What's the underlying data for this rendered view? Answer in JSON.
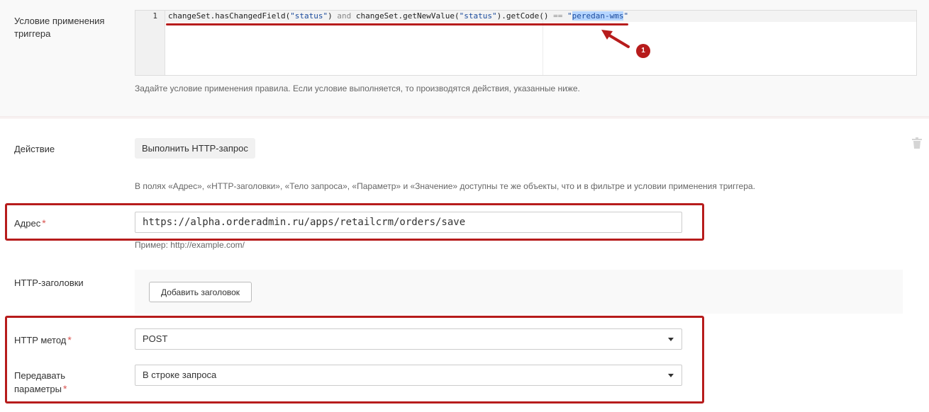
{
  "trigger_condition": {
    "label": "Условие применения триггера",
    "line_number": "1",
    "code": {
      "p1": "changeSet.hasChangedField(",
      "s1": "\"status\"",
      "p2": ") ",
      "k1": "and",
      "p3": " changeSet.getNewValue(",
      "s2": "\"status\"",
      "p4": ").getCode() ",
      "k2": "==",
      "p5": " ",
      "s3a": "\"",
      "s3b": "peredan-wms",
      "s3c": "\""
    },
    "hint": "Задайте условие применения правила. Если условие выполняется, то производятся действия, указанные ниже.",
    "annotation_badge": "1"
  },
  "action": {
    "label": "Действие",
    "button_label": "Выполнить HTTP-запрос",
    "hint": "В полях «Адрес», «HTTP-заголовки», «Тело запроса», «Параметр» и «Значение» доступны те же объекты, что и в фильтре и условии применения триггера."
  },
  "address": {
    "label": "Адрес",
    "required_mark": "*",
    "value": "https://alpha.orderadmin.ru/apps/retailcrm/orders/save",
    "example": "Пример: http://example.com/"
  },
  "http_headers": {
    "label": "HTTP-заголовки",
    "add_button": "Добавить заголовок"
  },
  "http_method": {
    "label": "HTTP метод",
    "required_mark": "*",
    "selected": "POST"
  },
  "pass_params": {
    "label_line1": "Передавать",
    "label_line2": "параметры",
    "required_mark": "*",
    "selected": "В строке запроса"
  },
  "colors": {
    "highlight": "#b71c1c",
    "required": "#d9534f",
    "selection": "#b5d5ff"
  },
  "icons": {
    "delete": "trash-icon",
    "dropdown": "caret-down-icon",
    "annotation": "arrow-icon"
  }
}
